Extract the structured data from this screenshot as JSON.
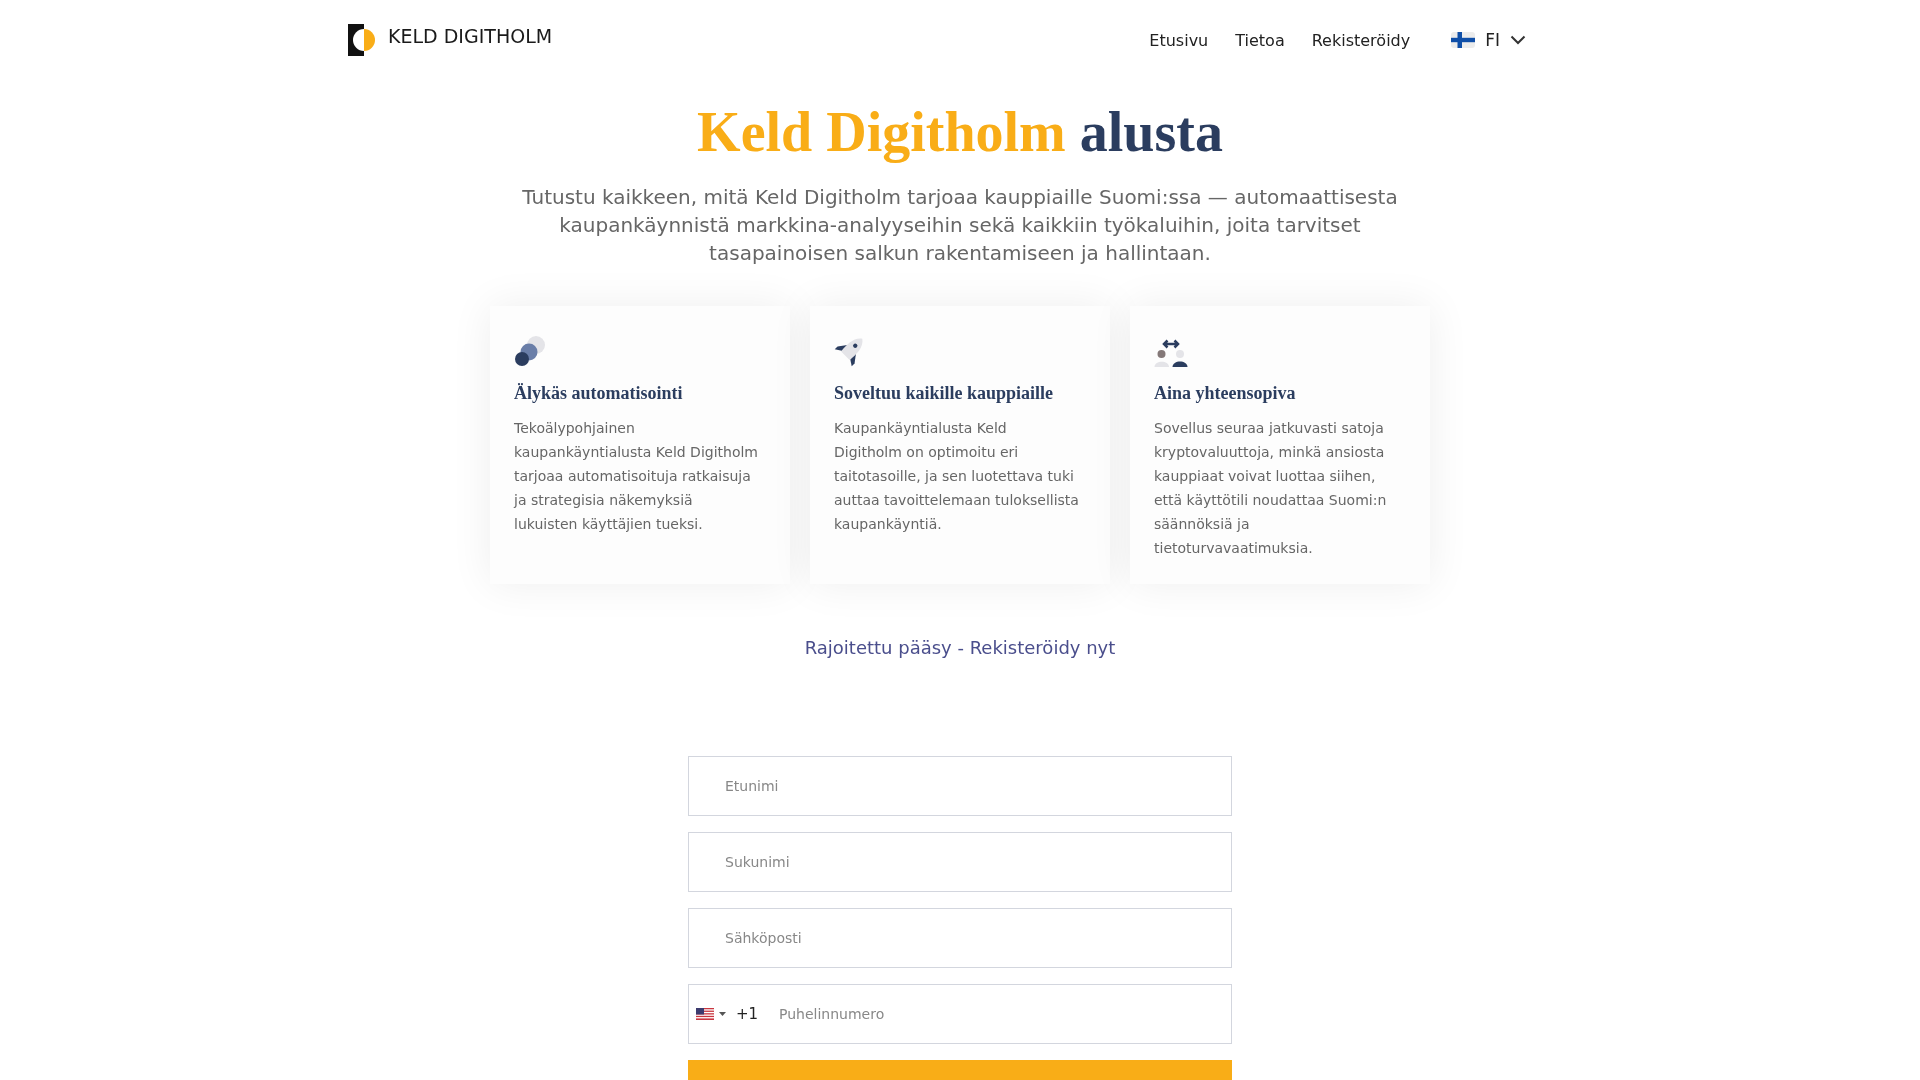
{
  "header": {
    "logo_text": "KELD DIGITHOLM",
    "nav": [
      {
        "label": "Etusivu"
      },
      {
        "label": "Tietoa"
      },
      {
        "label": "Rekisteröidy"
      }
    ],
    "language": {
      "label": "FI"
    }
  },
  "hero": {
    "title_parts": [
      {
        "text": "Keld Digitholm",
        "kind": "accent"
      },
      {
        "text": "alusta",
        "kind": "plain"
      }
    ],
    "subtitle": "Tutustu kaikkeen, mitä Keld Digitholm tarjoaa kauppiaille Suomi:ssa — automaattisesta kaupankäynnistä markkina-analyyseihin sekä kaikkiin työkaluihin, joita tarvitset tasapainoisen salkun rakentamiseen ja hallintaan."
  },
  "features": [
    {
      "title": "Älykäs automatisointi",
      "text": "Tekoälypohjainen kaupankäyntialusta Keld Digitholm tarjoaa automatisoituja ratkaisuja ja strategisia näkemyksiä lukuisten käyttäjien tueksi."
    },
    {
      "title": "Soveltuu kaikille kauppiaille",
      "text": "Kaupankäyntialusta Keld Digitholm on optimoitu eri taitotasoille, ja sen luotettava tuki auttaa tavoittelemaan tuloksellista kaupankäyntiä."
    },
    {
      "title": "Aina yhteensopiva",
      "text": "Sovellus seuraa jatkuvasti satoja kryptovaluuttoja, minkä ansiosta kauppiaat voivat luottaa siihen, että käyttötili noudattaa Suomi:n säännöksiä ja tietoturvavaatimuksia."
    }
  ],
  "cta_link": "Rajoitettu pääsy - Rekisteröidy nyt",
  "form": {
    "fields": [
      {
        "kind": "text",
        "placeholder": "Etunimi"
      },
      {
        "kind": "text",
        "placeholder": "Sukunimi"
      },
      {
        "kind": "text",
        "placeholder": "Sähköposti"
      },
      {
        "kind": "phone",
        "dial_code": "+1",
        "placeholder": "Puhelinnumero"
      }
    ]
  }
}
